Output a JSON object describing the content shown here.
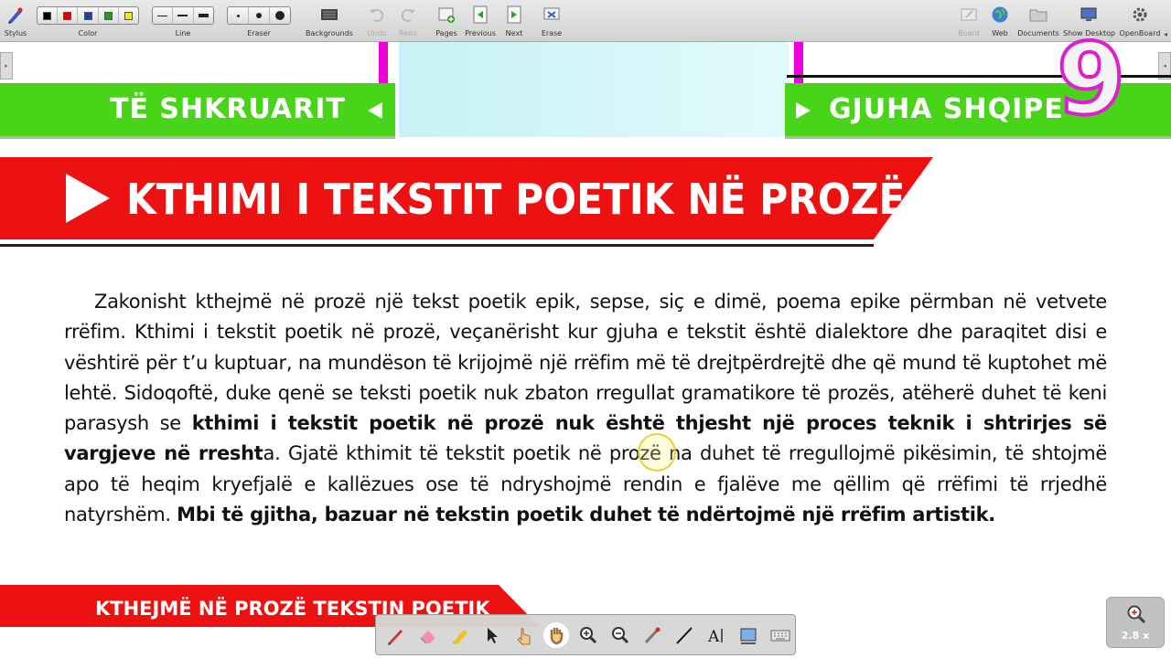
{
  "toolbar": {
    "stylus": "Stylus",
    "color": "Color",
    "line": "Line",
    "eraser": "Eraser",
    "backgrounds": "Backgrounds",
    "undo": "Undo",
    "redo": "Redo",
    "pages": "Pages",
    "previous": "Previous",
    "next": "Next",
    "erase": "Erase",
    "board": "Board",
    "web": "Web",
    "documents": "Documents",
    "show_desktop": "Show Desktop",
    "openboard": "OpenBoard",
    "colors": [
      "#000000",
      "#e00000",
      "#1a3fb0",
      "#1aa01a",
      "#f2e21a"
    ]
  },
  "header": {
    "left_label": "TË SHKRUARIT",
    "right_label": "GJUHA SHQIPE",
    "grade": "9"
  },
  "title": "KTHIMI I TEKSTIT POETIK NË PROZË",
  "paragraph": [
    {
      "text": "Zakonisht kthejmë në prozë një tekst poetik epik, sepse, siç e dimë, poema epike përmban në vetvete rrëfim. Kthimi i tekstit poetik në prozë, veçanërisht kur gjuha e tekstit është dialektore dhe paraqitet disi e vështirë për t’u kuptuar, na mundëson të krijojmë një rrëfim më të drejtpërdrejtë dhe që mund të kuptohet më lehtë. Sidoqoftë, duke qenë se teksti poetik nuk zbaton rregullat gramatikore të prozës, atëherë duhet të keni parasysh se ",
      "bold": false
    },
    {
      "text": "kthimi i tekstit poetik në prozë nuk është thjesht një proces teknik i shtrirjes së vargjeve në rresht",
      "bold": true
    },
    {
      "text": "a. Gjatë kthimit të tekstit poetik në prozë na duhet të rregullojmë pikësimin, të shtojmë apo të heqim kryefjalë e kallëzues ose të ndryshojmë rendin e fjalëve me qëllim që rrëfimi të rrjedhë natyrshëm. ",
      "bold": false
    },
    {
      "text": "Mbi të gjitha, bazuar në tekstin poetik duhet të ndërtojmë një rrëfim artistik.",
      "bold": true
    }
  ],
  "bottom_banner": "KTHEJMË NË PROZË TEKSTIN POETIK",
  "palette": {
    "tools": [
      "pen-icon",
      "eraser-icon",
      "marker-icon",
      "selector-icon",
      "interact-icon",
      "hand-icon",
      "zoom-in-icon",
      "zoom-out-icon",
      "laser-pointer-icon",
      "line-icon",
      "text-icon",
      "capture-icon",
      "keyboard-icon"
    ]
  },
  "zoom": {
    "level": "2.8 x"
  },
  "colors": {
    "green": "#48d418",
    "red": "#ee1111",
    "magenta": "#ee00dd"
  }
}
